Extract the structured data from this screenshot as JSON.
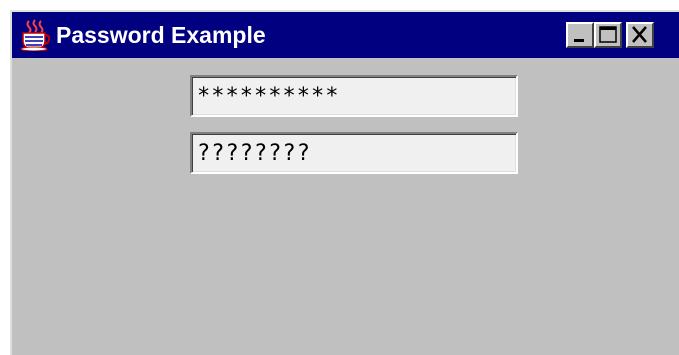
{
  "window": {
    "title": "Password Example",
    "title_bar_color": "#000080",
    "background_color": "#c0c0c0",
    "app_icon": "java-coffee-cup-icon",
    "controls": {
      "minimize_icon": "minimize-icon",
      "maximize_icon": "maximize-icon",
      "close_icon": "close-icon"
    }
  },
  "fields": {
    "password_field": {
      "value": "**********",
      "echo_char": "*"
    },
    "password_field_2": {
      "value": "????????",
      "echo_char": "?"
    }
  }
}
